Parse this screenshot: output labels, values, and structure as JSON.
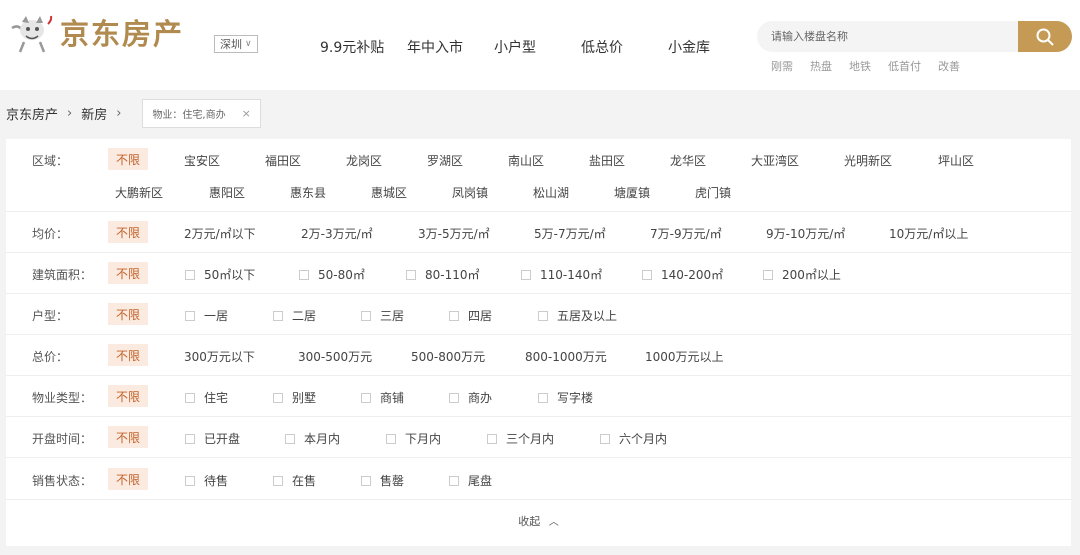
{
  "header": {
    "logo_text": "京东房产",
    "city": "深圳",
    "nav": [
      "9.9元补贴",
      "年中入市",
      "小户型",
      "低总价",
      "小金库"
    ],
    "search_placeholder": "请输入楼盘名称",
    "hot_tags": [
      "刚需",
      "热盘",
      "地铁",
      "低首付",
      "改善"
    ]
  },
  "breadcrumb": {
    "home": "京东房产",
    "current": "新房",
    "sep": "›",
    "filter_tag": "物业：住宅,商办",
    "close": "×"
  },
  "filters": {
    "region": {
      "label": "区域：",
      "any": "不限",
      "row1": [
        "宝安区",
        "福田区",
        "龙岗区",
        "罗湖区",
        "南山区",
        "盐田区",
        "龙华区",
        "大亚湾区",
        "光明新区",
        "坪山区"
      ],
      "row2": [
        "大鹏新区",
        "惠阳区",
        "惠东县",
        "惠城区",
        "凤岗镇",
        "松山湖",
        "塘厦镇",
        "虎门镇"
      ]
    },
    "price": {
      "label": "均价：",
      "any": "不限",
      "options": [
        "2万元/㎡以下",
        "2万-3万元/㎡",
        "3万-5万元/㎡",
        "5万-7万元/㎡",
        "7万-9万元/㎡",
        "9万-10万元/㎡",
        "10万元/㎡以上"
      ]
    },
    "area": {
      "label": "建筑面积：",
      "any": "不限",
      "options": [
        "50㎡以下",
        "50-80㎡",
        "80-110㎡",
        "110-140㎡",
        "140-200㎡",
        "200㎡以上"
      ]
    },
    "layout": {
      "label": "户型：",
      "any": "不限",
      "options": [
        "一居",
        "二居",
        "三居",
        "四居",
        "五居及以上"
      ]
    },
    "total": {
      "label": "总价：",
      "any": "不限",
      "options": [
        "300万元以下",
        "300-500万元",
        "500-800万元",
        "800-1000万元",
        "1000万元以上"
      ]
    },
    "property": {
      "label": "物业类型：",
      "any": "不限",
      "options": [
        "住宅",
        "别墅",
        "商铺",
        "商办",
        "写字楼"
      ]
    },
    "opening": {
      "label": "开盘时间：",
      "any": "不限",
      "options": [
        "已开盘",
        "本月内",
        "下月内",
        "三个月内",
        "六个月内"
      ]
    },
    "sale": {
      "label": "销售状态：",
      "any": "不限",
      "options": [
        "待售",
        "在售",
        "售罄",
        "尾盘"
      ]
    }
  },
  "collapse_label": "收起",
  "colors": {
    "brand": "#b08a4f",
    "search_btn": "#c59a55",
    "selected_bg": "#fbeadf",
    "selected_text": "#c2622a"
  }
}
